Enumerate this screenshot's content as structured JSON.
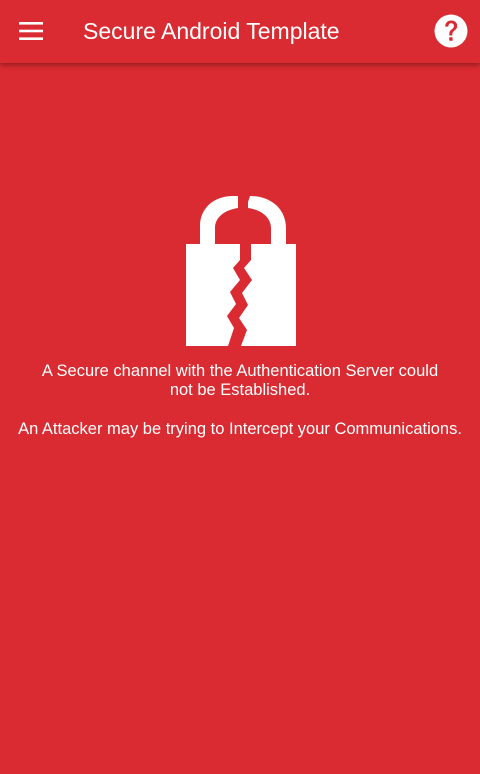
{
  "app_bar": {
    "title": "Secure Android Template",
    "menu_icon": "hamburger-menu-icon",
    "help_icon": "help-icon"
  },
  "main": {
    "icon": "broken-lock-icon",
    "message_primary": "A Secure channel with the Authentication Server could not be Established.",
    "message_secondary": "An Attacker may be trying to Intercept your Communications."
  },
  "colors": {
    "background": "#d92b31",
    "foreground": "#ffffff"
  }
}
